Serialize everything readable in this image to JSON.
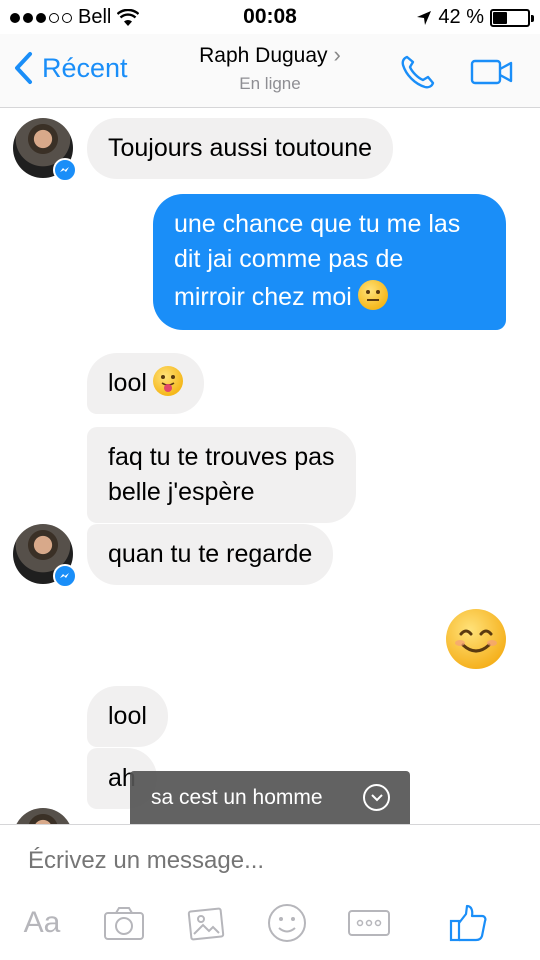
{
  "status_bar": {
    "carrier": "Bell",
    "signal_bars": 3,
    "signal_total": 5,
    "time": "00:08",
    "battery_percent": "42 %",
    "battery_level": 0.42
  },
  "nav": {
    "back_label": "Récent",
    "contact_name": "Raph Duguay",
    "contact_status": "En ligne"
  },
  "messages": [
    {
      "direction": "in",
      "text": "Toujours aussi toutoune"
    },
    {
      "direction": "out",
      "line1": "une chance que tu me las",
      "line2": "dit jai comme pas de",
      "line3": "mirroir chez moi",
      "emoji": "neutral-face"
    },
    {
      "direction": "in",
      "text": "lool",
      "emoji": "tongue-face"
    },
    {
      "direction": "in",
      "line1": "faq tu te trouves pas",
      "line2": "belle j'espère"
    },
    {
      "direction": "in",
      "text": "quan tu te regarde"
    },
    {
      "direction": "out",
      "emoji": "smiling-face"
    },
    {
      "direction": "in",
      "text": "lool"
    },
    {
      "direction": "in",
      "text": "ah"
    }
  ],
  "toast": {
    "text": "sa cest un homme"
  },
  "composer": {
    "placeholder": "Écrivez un message...",
    "aa_label": "Aa"
  },
  "colors": {
    "accent": "#1a8ef8",
    "incoming_bubble": "#f1f0f0",
    "muted": "#b6b6bb"
  }
}
